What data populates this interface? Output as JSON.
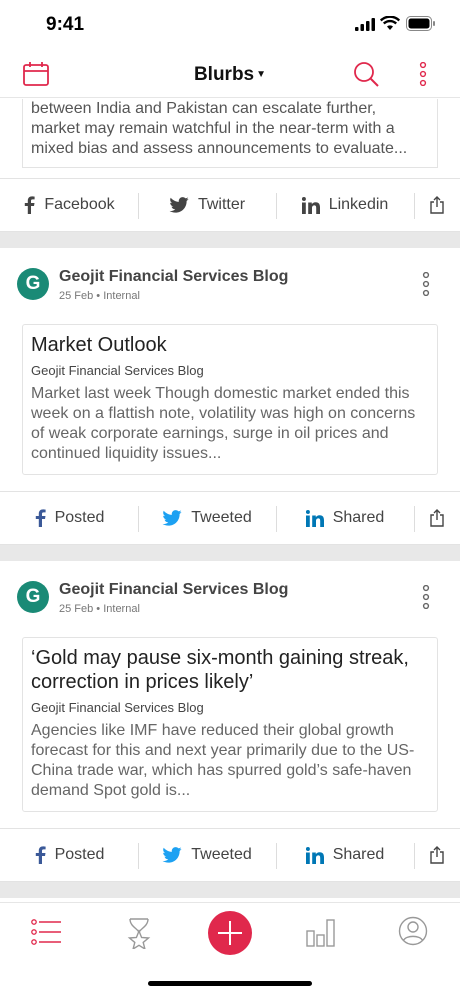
{
  "status_bar": {
    "time": "9:41"
  },
  "app_bar": {
    "title": "Blurbs"
  },
  "colors": {
    "accent": "#e0284c",
    "facebook": "#3b5998",
    "twitter": "#1da1f2",
    "linkedin": "#0077b5",
    "brand_green": "#1a8a76"
  },
  "snippet": {
    "excerpt": "Political strategist believes that this geo-political risk between India and Pakistan can escalate further, market may remain watchful in the near-term with a mixed bias and assess announcements to evaluate...",
    "share": {
      "facebook": "Facebook",
      "twitter": "Twitter",
      "linkedin": "Linkedin"
    }
  },
  "posts": [
    {
      "source": "Geojit Financial Services Blog",
      "meta": "25 Feb • Internal",
      "title": "Market Outlook",
      "article_source": "Geojit Financial Services Blog",
      "body": "Market last week Though domestic market ended this week on a flattish note, volatility was high on concerns of weak corporate earnings, surge in oil prices and continued liquidity issues...",
      "share": {
        "facebook": "Posted",
        "twitter": "Tweeted",
        "linkedin": "Shared"
      }
    },
    {
      "source": "Geojit Financial Services Blog",
      "meta": "25 Feb • Internal",
      "title": "‘Gold may pause six-month gaining streak, correction in prices likely’",
      "article_source": "Geojit Financial Services Blog",
      "body": "Agencies like IMF have reduced their global growth forecast for this and next year primarily due to the US-China trade war, which has spurred gold’s safe-haven demand Spot gold is...",
      "share": {
        "facebook": "Posted",
        "twitter": "Tweeted",
        "linkedin": "Shared"
      }
    }
  ],
  "bottom_nav": {
    "icons": [
      "list-icon",
      "hourglass-star-icon",
      "add-icon",
      "bar-chart-icon",
      "profile-icon"
    ]
  }
}
